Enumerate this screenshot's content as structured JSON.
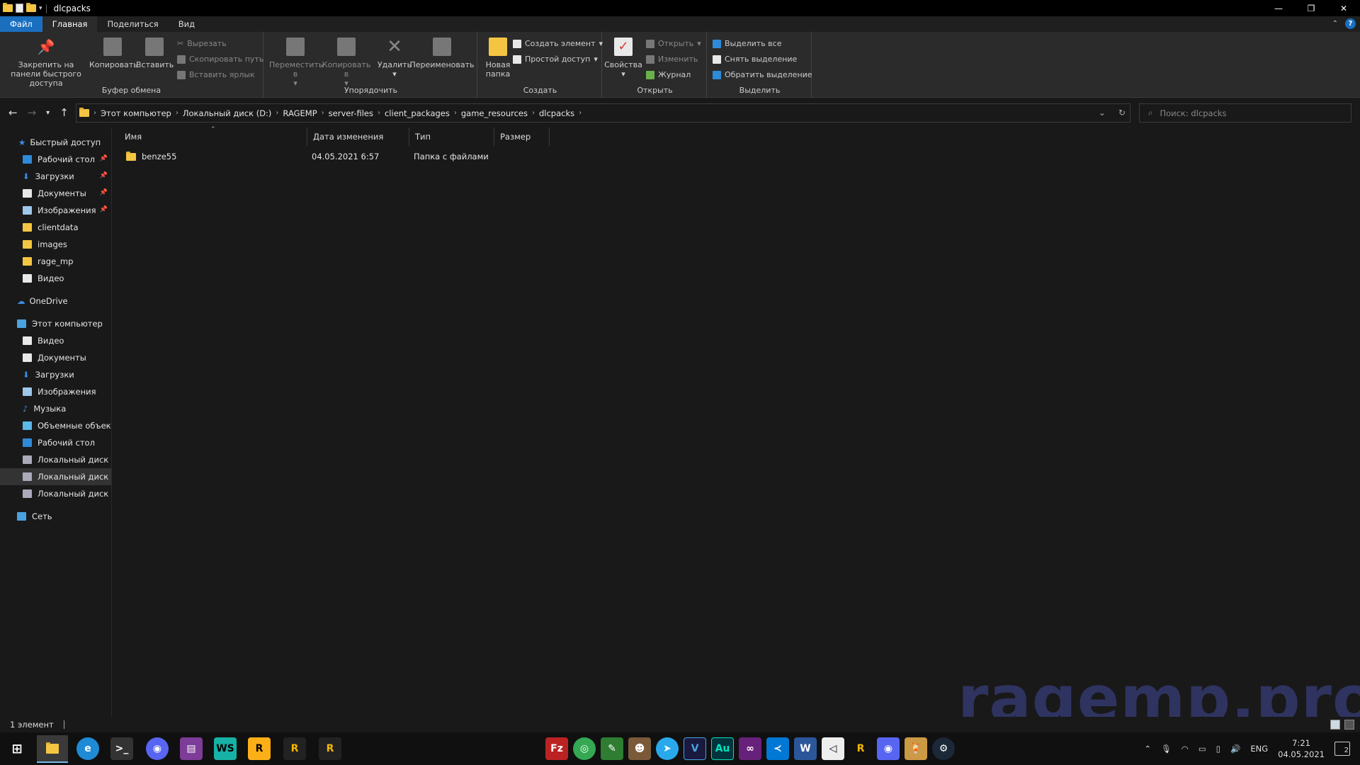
{
  "window": {
    "title": "dlcpacks"
  },
  "menu": {
    "file": "Файл",
    "home": "Главная",
    "share": "Поделиться",
    "view": "Вид"
  },
  "ribbon": {
    "clipboard": {
      "label": "Буфер обмена",
      "pin": "Закрепить на панели быстрого доступа",
      "copy": "Копировать",
      "paste": "Вставить",
      "cut": "Вырезать",
      "copy_path": "Скопировать путь",
      "paste_shortcut": "Вставить ярлык"
    },
    "organize": {
      "label": "Упорядочить",
      "move": "Переместить в",
      "copy_to": "Копировать в",
      "delete": "Удалить",
      "rename": "Переименовать"
    },
    "create": {
      "label": "Создать",
      "new_folder": "Новая папка",
      "new_item": "Создать элемент",
      "easy_access": "Простой доступ"
    },
    "open": {
      "label": "Открыть",
      "properties": "Свойства",
      "open": "Открыть",
      "edit": "Изменить",
      "history": "Журнал"
    },
    "select": {
      "label": "Выделить",
      "select_all": "Выделить все",
      "select_none": "Снять выделение",
      "invert": "Обратить выделение"
    }
  },
  "address": {
    "crumbs": [
      "Этот компьютер",
      "Локальный диск (D:)",
      "RAGEMP",
      "server-files",
      "client_packages",
      "game_resources",
      "dlcpacks"
    ],
    "search_placeholder": "Поиск: dlcpacks"
  },
  "navpane": {
    "quick_access": "Быстрый доступ",
    "quick_items": [
      "Рабочий стол",
      "Загрузки",
      "Документы",
      "Изображения",
      "clientdata",
      "images",
      "rage_mp",
      "Видео"
    ],
    "onedrive": "OneDrive",
    "this_pc": "Этот компьютер",
    "pc_items": [
      "Видео",
      "Документы",
      "Загрузки",
      "Изображения",
      "Музыка",
      "Объемные объекты",
      "Рабочий стол",
      "Локальный диск (C:)",
      "Локальный диск (D:)",
      "Локальный диск (Z:)"
    ],
    "network": "Сеть"
  },
  "columns": {
    "name": "Имя",
    "date": "Дата изменения",
    "type": "Тип",
    "size": "Размер"
  },
  "files": [
    {
      "name": "benze55",
      "date": "04.05.2021 6:57",
      "type": "Папка с файлами",
      "size": ""
    }
  ],
  "status": {
    "count": "1 элемент"
  },
  "watermark": "ragemp.pro",
  "tray": {
    "lang": "ENG",
    "time": "7:21",
    "date": "04.05.2021",
    "notifications": "2"
  },
  "taskbar_letters": {
    "webstorm": "WS",
    "vstudio": "V",
    "audition": "Au",
    "word": "W",
    "rockstar": "R"
  }
}
